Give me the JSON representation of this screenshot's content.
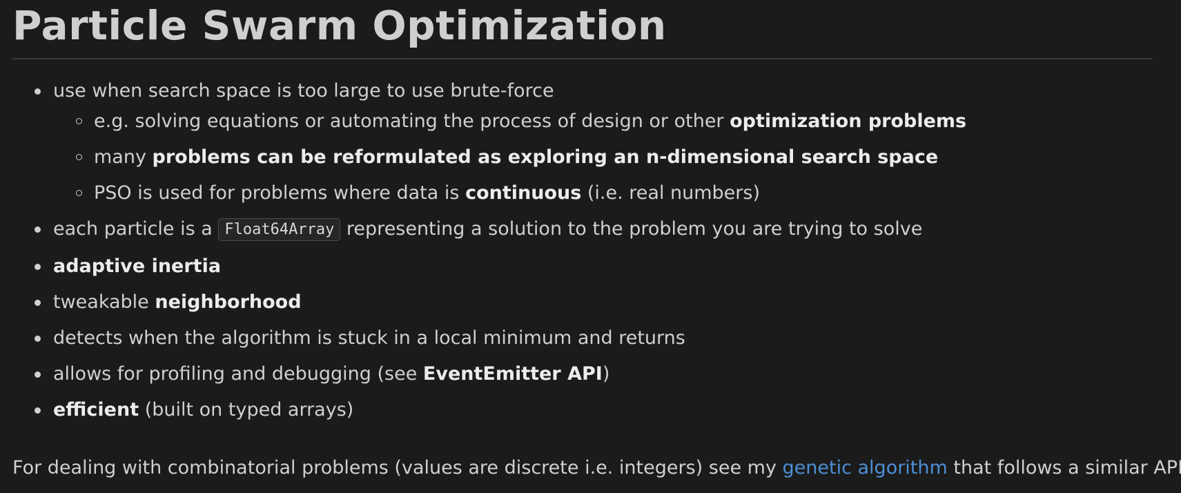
{
  "title": "Particle Swarm Optimization",
  "list": {
    "item1": {
      "text": "use when search space is too large to use brute-force",
      "sub1": {
        "pre": "e.g. solving equations or automating the process of design or other ",
        "bold": "optimization problems"
      },
      "sub2": {
        "pre": "many ",
        "bold": "problems can be reformulated as exploring an n-dimensional search space"
      },
      "sub3": {
        "pre": "PSO is used for problems where data is ",
        "bold": "continuous",
        "post": " (i.e. real numbers)"
      }
    },
    "item2": {
      "pre": "each particle is a ",
      "code": "Float64Array",
      "post": " representing a solution to the problem you are trying to solve"
    },
    "item3": {
      "bold": "adaptive inertia"
    },
    "item4": {
      "pre": "tweakable ",
      "bold": "neighborhood"
    },
    "item5": {
      "text": "detects when the algorithm is stuck in a local minimum and returns"
    },
    "item6": {
      "pre": "allows for profiling and debugging (see ",
      "bold": "EventEmitter API",
      "post": ")"
    },
    "item7": {
      "bold": "efficient",
      "post": " (built on typed arrays)"
    }
  },
  "footer": {
    "pre": "For dealing with combinatorial problems (values are discrete i.e. integers) see my ",
    "link": "genetic algorithm",
    "post": " that follows a similar API."
  },
  "colors": {
    "background": "#1b1b1b",
    "text": "#d0d0d0",
    "link": "#4d8fd6"
  }
}
